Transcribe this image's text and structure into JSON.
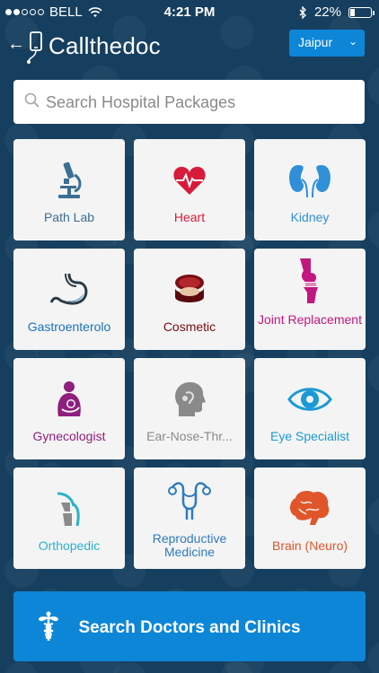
{
  "status": {
    "carrier": "BELL",
    "time": "4:21 PM",
    "battery": "22%",
    "battery_level": 0.22
  },
  "header": {
    "app_name": "Callthedoc",
    "city": "Jaipur"
  },
  "search": {
    "placeholder": "Search Hospital Packages",
    "value": ""
  },
  "categories": [
    {
      "label": "Path Lab",
      "color": "#3b6f93",
      "icon": "microscope-icon"
    },
    {
      "label": "Heart",
      "color": "#d81b3a",
      "icon": "heart-icon"
    },
    {
      "label": "Kidney",
      "color": "#2f8fd8",
      "icon": "kidney-icon"
    },
    {
      "label": "Gastroenterolo",
      "color": "#1a73b8",
      "icon": "stomach-icon"
    },
    {
      "label": "Cosmetic",
      "color": "#7a0d12",
      "icon": "compact-icon"
    },
    {
      "label": "Joint Replacement",
      "color": "#c2177f",
      "icon": "knee-joint-icon"
    },
    {
      "label": "Gynecologist",
      "color": "#8e1f7e",
      "icon": "mother-baby-icon"
    },
    {
      "label": "Ear-Nose-Thr...",
      "color": "#8a8a8a",
      "icon": "head-profile-icon"
    },
    {
      "label": "Eye Specialist",
      "color": "#1a9ad6",
      "icon": "eye-icon"
    },
    {
      "label": "Orthopedic",
      "color": "#2bb1c9",
      "icon": "bone-joint-icon"
    },
    {
      "label": "Reproductive Medicine",
      "color": "#2f7bbf",
      "icon": "uterus-icon"
    },
    {
      "label": "Brain (Neuro)",
      "color": "#e0552a",
      "icon": "brain-icon"
    }
  ],
  "cta": {
    "label": "Search Doctors and Clinics"
  }
}
